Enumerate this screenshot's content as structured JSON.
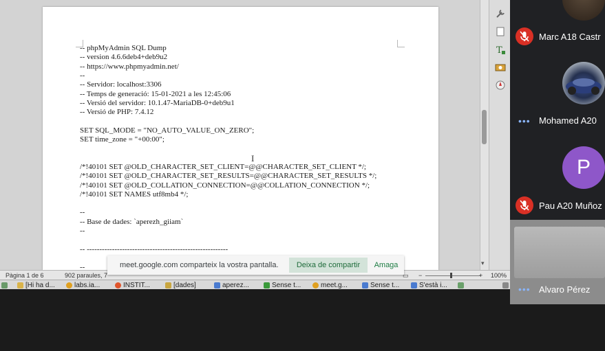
{
  "document": {
    "lines": [
      "-- phpMyAdmin SQL Dump",
      "-- version 4.6.6deb4+deb9u2",
      "-- https://www.phpmyadmin.net/",
      "--",
      "-- Servidor: localhost:3306",
      "-- Temps de generació: 15-01-2021 a les 12:45:06",
      "-- Versió del servidor: 10.1.47-MariaDB-0+deb9u1",
      "-- Versió de PHP: 7.4.12",
      "",
      "SET SQL_MODE = \"NO_AUTO_VALUE_ON_ZERO\";",
      "SET time_zone = \"+00:00\";",
      "",
      "",
      "/*!40101 SET @OLD_CHARACTER_SET_CLIENT=@@CHARACTER_SET_CLIENT */;",
      "/*!40101 SET @OLD_CHARACTER_SET_RESULTS=@@CHARACTER_SET_RESULTS */;",
      "/*!40101 SET @OLD_COLLATION_CONNECTION=@@COLLATION_CONNECTION */;",
      "/*!40101 SET NAMES utf8mb4 */;",
      "",
      "--",
      "-- Base de dades: `aperezh_giiam`",
      "--",
      "",
      "-- --------------------------------------------------------",
      "",
      "--"
    ]
  },
  "statusbar": {
    "page": "Pàgina 1 de 6",
    "words": "902 paraules, 7",
    "zoom": "100%"
  },
  "share_banner": {
    "message": "meet.google.com comparteix la vostra pantalla.",
    "stop_label": "Deixa de compartir",
    "hide_label": "Amaga"
  },
  "taskbar": {
    "items": [
      {
        "label": "[Hi ha d...",
        "icon": "folder-icon",
        "color": "#d9b34a"
      },
      {
        "label": "labs.ia...",
        "icon": "chrome-icon",
        "color": "#e0a020"
      },
      {
        "label": "INSTIT...",
        "icon": "firefox-icon",
        "color": "#e0552c"
      },
      {
        "label": "[dades]",
        "icon": "folder-icon",
        "color": "#c9a640"
      },
      {
        "label": "aperez...",
        "icon": "writer-icon",
        "color": "#4a7bd0"
      },
      {
        "label": "Sense t...",
        "icon": "calc-icon",
        "color": "#3a9a3a"
      },
      {
        "label": "meet.g...",
        "icon": "chrome-icon",
        "color": "#e0a020"
      },
      {
        "label": "Sense t...",
        "icon": "writer-icon",
        "color": "#4a7bd0"
      },
      {
        "label": "S'està i...",
        "icon": "document-icon",
        "color": "#4a7bd0"
      }
    ]
  },
  "participants": [
    {
      "name": "Marc A18 Castr",
      "muted": true
    },
    {
      "name": "Mohamed A20 ",
      "muted": false
    },
    {
      "name": "Pau A20 Muñoz",
      "muted": true,
      "initial": "P",
      "avatar_color": "#8e57c9"
    },
    {
      "name": "Alvaro Pérez",
      "muted": false
    }
  ]
}
